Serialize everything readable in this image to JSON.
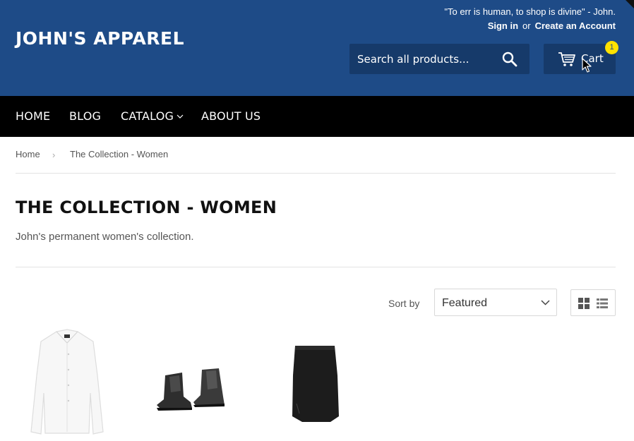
{
  "header": {
    "logo": "JOHN'S APPAREL",
    "tagline": "\"To err is human, to shop is divine\" - John.",
    "sign_in": "Sign in",
    "or": "or",
    "create_account": "Create an Account",
    "search_placeholder": "Search all products...",
    "cart_label": "Cart",
    "cart_count": "1",
    "brand_color": "#1e4b87",
    "button_color": "#163a6a",
    "badge_color": "#ffe200"
  },
  "nav": {
    "items": [
      {
        "label": "HOME"
      },
      {
        "label": "BLOG"
      },
      {
        "label": "CATALOG"
      },
      {
        "label": "ABOUT US"
      }
    ]
  },
  "breadcrumb": {
    "home": "Home",
    "separator": "›",
    "current": "The Collection - Women"
  },
  "collection": {
    "title": "THE COLLECTION - WOMEN",
    "description": "John's permanent women's collection."
  },
  "sort": {
    "label": "Sort by",
    "selected": "Featured"
  },
  "icons": {
    "search": "search-icon",
    "cart": "cart-icon",
    "chevron": "chevron-down-icon",
    "grid_view": "grid-view-icon",
    "list_view": "list-view-icon"
  },
  "products": [
    {
      "image": "white-shirt"
    },
    {
      "image": "black-ankle-boots"
    },
    {
      "image": "black-skirt"
    }
  ]
}
